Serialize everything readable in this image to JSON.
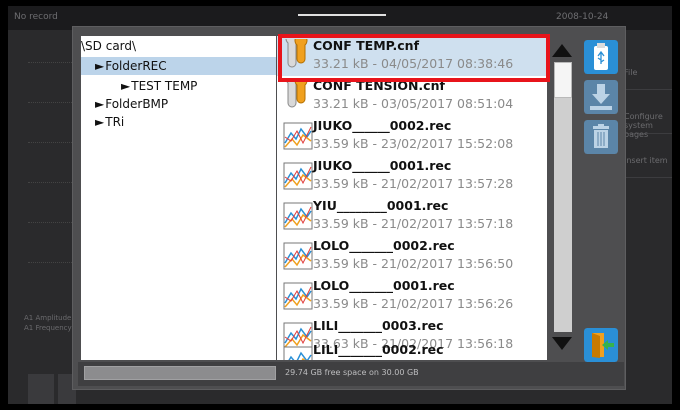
{
  "background": {
    "status": "No record",
    "clock": "2008-10-24",
    "right_panel": [
      "File",
      "Configure\nsystem pages",
      "Insert item"
    ],
    "left_labels": [
      "A1 Amplitude",
      "A1 Frequency"
    ]
  },
  "tree": {
    "root": "\\SD card\\",
    "items": [
      {
        "label": "FolderREC",
        "level": 1,
        "selected": true
      },
      {
        "label": "TEST TEMP",
        "level": 2,
        "selected": false
      },
      {
        "label": "FolderBMP",
        "level": 1,
        "selected": false
      },
      {
        "label": "TRi",
        "level": 1,
        "selected": false
      }
    ],
    "arrow": "►"
  },
  "files": [
    {
      "name": "CONF TEMP.cnf",
      "meta": "33.21 kB - 04/05/2017 08:38:46",
      "icon": "config-file-icon"
    },
    {
      "name": "CONF TENSION.cnf",
      "meta": "33.21 kB - 03/05/2017 08:51:04",
      "icon": "config-file-icon"
    },
    {
      "name": "JIUKO______0002.rec",
      "meta": "33.59 kB - 23/02/2017 15:52:08",
      "icon": "record-file-icon"
    },
    {
      "name": "JIUKO______0001.rec",
      "meta": "33.59 kB - 21/02/2017 13:57:28",
      "icon": "record-file-icon"
    },
    {
      "name": "YIU________0001.rec",
      "meta": "33.59 kB - 21/02/2017 13:57:18",
      "icon": "record-file-icon"
    },
    {
      "name": "LOLO_______0002.rec",
      "meta": "33.59 kB - 21/02/2017 13:56:50",
      "icon": "record-file-icon"
    },
    {
      "name": "LOLO_______0001.rec",
      "meta": "33.59 kB - 21/02/2017 13:56:26",
      "icon": "record-file-icon"
    },
    {
      "name": "LILI_______0003.rec",
      "meta": "33.63 kB - 21/02/2017 13:56:18",
      "icon": "record-file-icon"
    },
    {
      "name": "LILI_______0002.rec",
      "meta": "",
      "icon": "record-file-icon"
    }
  ],
  "status": {
    "free_space": "29.74 GB free space on 30.00 GB"
  },
  "colors": {
    "highlight": "#e8141b",
    "accent": "#2a8fd6",
    "exit": "#37b24d"
  }
}
